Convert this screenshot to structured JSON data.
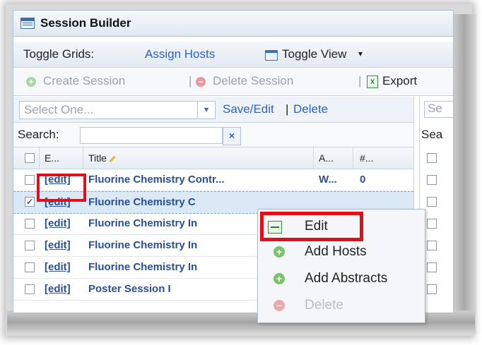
{
  "window": {
    "title": "Session Builder"
  },
  "toolbar1": {
    "label": "Toggle Grids:",
    "assign_hosts": "Assign Hosts",
    "toggle_view": "Toggle View"
  },
  "toolbar2": {
    "create": "Create Session",
    "sep": "|",
    "delete": "Delete Session",
    "export": "Export"
  },
  "filter": {
    "select_placeholder": "Select One...",
    "save_edit": "Save/Edit",
    "sep": "|",
    "delete": "Delete"
  },
  "search": {
    "label": "Search:",
    "clear": "×"
  },
  "columns": {
    "edit": "E...",
    "title": "Title",
    "a": "A...",
    "n": "#..."
  },
  "rows": [
    {
      "edit": "[edit]",
      "title": "Fluorine Chemistry Contr...",
      "a": "W...",
      "n": "0",
      "checked": false
    },
    {
      "edit": "[edit]",
      "title": "Fluorine Chemistry C",
      "a": "",
      "n": "",
      "checked": true
    },
    {
      "edit": "[edit]",
      "title": "Fluorine Chemistry In",
      "a": "",
      "n": "",
      "checked": false
    },
    {
      "edit": "[edit]",
      "title": "Fluorine Chemistry In",
      "a": "",
      "n": "",
      "checked": false
    },
    {
      "edit": "[edit]",
      "title": "Fluorine Chemistry In",
      "a": "",
      "n": "",
      "checked": false
    },
    {
      "edit": "[edit]",
      "title": "Poster Session I",
      "a": "",
      "n": "",
      "checked": false
    }
  ],
  "context_menu": {
    "items": [
      {
        "label": "Edit",
        "icon": "edit-icon",
        "enabled": true
      },
      {
        "label": "Add Hosts",
        "icon": "add-icon",
        "enabled": true
      },
      {
        "label": "Add Abstracts",
        "icon": "add-icon",
        "enabled": true
      },
      {
        "label": "Delete",
        "icon": "delete-icon",
        "enabled": false
      }
    ]
  },
  "right_panel": {
    "select_placeholder": "Se",
    "search_label": "Sea"
  },
  "colors": {
    "link": "#2a62c9",
    "highlight": "#e0101a",
    "selected_row": "#dbe8f6"
  }
}
